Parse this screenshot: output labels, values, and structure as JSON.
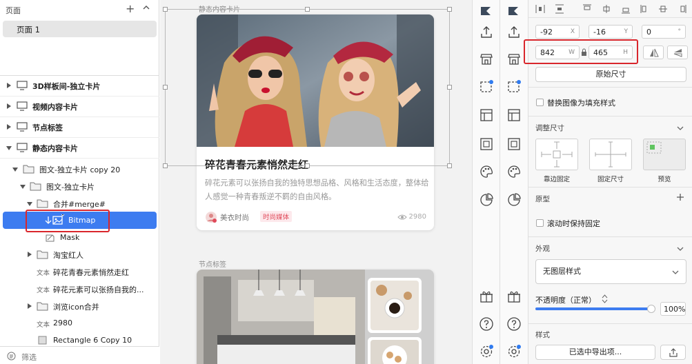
{
  "pages_panel": {
    "title": "页面",
    "add": "+",
    "pages": [
      {
        "label": "页面 1"
      }
    ]
  },
  "layers": [
    {
      "label": "3D样板间-独立卡片"
    },
    {
      "label": "视频内容卡片"
    },
    {
      "label": "节点标签"
    },
    {
      "label": "静态内容卡片"
    },
    {
      "label": "图文-独立卡片 copy 20"
    },
    {
      "label": "图文-独立卡片"
    },
    {
      "label": "合并#merge#"
    },
    {
      "label": "Bitmap"
    },
    {
      "label": "Mask"
    },
    {
      "label": "淘宝红人"
    },
    {
      "kind": "文本",
      "label": "碎花青春元素悄然走红"
    },
    {
      "kind": "文本",
      "label": "碎花元素可以张扬自我的..."
    },
    {
      "label": "浏览icon合并"
    },
    {
      "kind": "文本",
      "label": "2980"
    },
    {
      "label": "Rectangle 6 Copy 10"
    }
  ],
  "filter_label": "筛选",
  "canvas": {
    "artboard1_label": "静态内容卡片",
    "artboard2_label": "节点标签",
    "card": {
      "title": "碎花青春元素悄然走红",
      "desc": "碎花元素可以张扬自我的独特思想品格、风格和生活态度，整体给人感觉一种青春叛逆不羁的自由风格。",
      "source": "美衣时尚",
      "tag": "时尚媒体",
      "views": "2980"
    }
  },
  "inspector": {
    "x": {
      "value": "-92",
      "unit": "X"
    },
    "y": {
      "value": "-16",
      "unit": "Y"
    },
    "rotation": {
      "value": "0",
      "unit": "°"
    },
    "w": {
      "value": "842",
      "unit": "W"
    },
    "h": {
      "value": "465",
      "unit": "H"
    },
    "original_size": "原始尺寸",
    "replace_fill": "替换图像为填充样式",
    "resize_head": "调整尺寸",
    "resize_options": [
      "靠边固定",
      "固定尺寸",
      "预览"
    ],
    "prototype_head": "原型",
    "fix_on_scroll": "滚动时保持固定",
    "appearance_head": "外观",
    "layer_style": "无图层样式",
    "opacity_label": "不透明度（正常）",
    "opacity_value": "100%",
    "opacity_level": 1.0,
    "style_head": "样式",
    "export_selected": "已选中导出项..."
  },
  "colors": {
    "selection": "#3d7cf0",
    "highlight": "#d9262c",
    "tag_text": "#e04a5a"
  }
}
